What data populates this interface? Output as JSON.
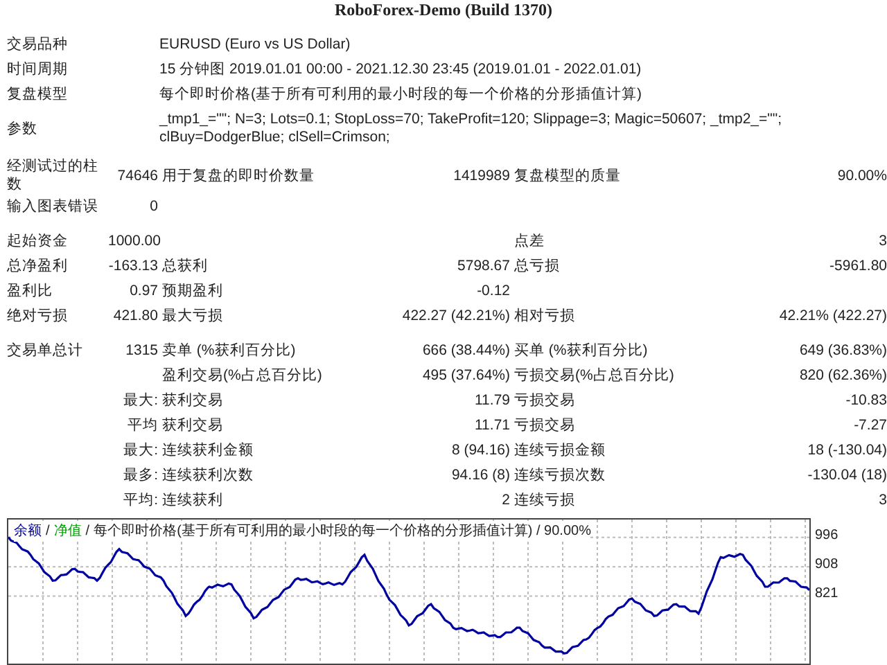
{
  "title": "RoboForex-Demo (Build 1370)",
  "info": [
    {
      "label": "交易品种",
      "value": "EURUSD (Euro vs US Dollar)"
    },
    {
      "label": "时间周期",
      "value": "15 分钟图 2019.01.01 00:00 - 2021.12.30 23:45 (2019.01.01 - 2022.01.01)"
    },
    {
      "label": "复盘模型",
      "value": "每个即时价格(基于所有可利用的最小时段的每一个价格的分形插值计算)"
    },
    {
      "label": "参数",
      "value": "_tmp1_=\"\"; N=3; Lots=0.1; StopLoss=70; TakeProfit=120; Slippage=3; Magic=50607; _tmp2_=\"\"; clBuy=DodgerBlue; clSell=Crimson;"
    }
  ],
  "sections": [
    [
      {
        "label_1": "经测试过的柱数",
        "value_1": "74646",
        "label_2": "用于复盘的即时价数量",
        "value_2": "1419989",
        "label_3": "复盘模型的质量",
        "value_3": "90.00%"
      },
      {
        "label_1": "输入图表错误",
        "value_1": "0"
      }
    ],
    [
      {
        "label_1": "起始资金",
        "value_1": "1000.00",
        "label_3": "点差",
        "value_3": "3"
      },
      {
        "label_1": "总净盈利",
        "value_1": "-163.13",
        "label_2": "总获利",
        "value_2": "5798.67",
        "label_3": "总亏损",
        "value_3": "-5961.80"
      },
      {
        "label_1": "盈利比",
        "value_1": "0.97",
        "label_2": "预期盈利",
        "value_2": "-0.12"
      },
      {
        "label_1": "绝对亏损",
        "value_1": "421.80",
        "label_2": "最大亏损",
        "value_2": "422.27 (42.21%)",
        "label_3": "相对亏损",
        "value_3": "42.21% (422.27)"
      }
    ],
    [
      {
        "label_1": "交易单总计",
        "value_1": "1315",
        "label_2": "卖单 (%获利百分比)",
        "value_2": "666 (38.44%)",
        "label_3": "买单 (%获利百分比)",
        "value_3": "649 (36.83%)"
      },
      {
        "label_2": "盈利交易(%占总百分比)",
        "value_2": "495 (37.64%)",
        "label_3": "亏损交易(%占总百分比)",
        "value_3": "820 (62.36%)"
      },
      {
        "value_1": "最大:",
        "label_2": "获利交易",
        "value_2": "11.79",
        "label_3": "亏损交易",
        "value_3": "-10.83"
      },
      {
        "value_1": "平均",
        "label_2": "获利交易",
        "value_2": "11.71",
        "label_3": "亏损交易",
        "value_3": "-7.27"
      },
      {
        "value_1": "最大:",
        "label_2": "连续获利金额",
        "value_2": "8 (94.16)",
        "label_3": "连续亏损金额",
        "value_3": "18 (-130.04)"
      },
      {
        "value_1": "最多:",
        "label_2": "连续获利次数",
        "value_2": "94.16 (8)",
        "label_3": "连续亏损次数",
        "value_3": "-130.04 (18)"
      },
      {
        "value_1": "平均:",
        "label_2": "连续获利",
        "value_2": "2",
        "label_3": "连续亏损",
        "value_3": "3"
      }
    ]
  ],
  "chart": {
    "legend": [
      {
        "text": "净值",
        "color": "#00a000"
      }
    ],
    "separator": "/",
    "legend_rest": "每个即时价格(基于所有可利用的最小时段的每一个价格的分形插值计算) / 90.00%",
    "chart_data": {
      "type": "line",
      "grid": true,
      "ylim": [
        620,
        1049
      ],
      "yticks": [
        {
          "value": 996,
          "label": "996"
        },
        {
          "value": 908,
          "label": "908"
        },
        {
          "value": 821,
          "label": "821"
        }
      ],
      "series": [
        {
          "name": "余额",
          "color": "#0000a0",
          "values": [
            996,
            944,
            867,
            902,
            867,
            961,
            919,
            867,
            762,
            849,
            856,
            755,
            814,
            874,
            860,
            856,
            944,
            825,
            734,
            797,
            727,
            716,
            699,
            727,
            674,
            650,
            692,
            762,
            814,
            762,
            797,
            769,
            937,
            944,
            849,
            874,
            839
          ]
        }
      ]
    }
  }
}
